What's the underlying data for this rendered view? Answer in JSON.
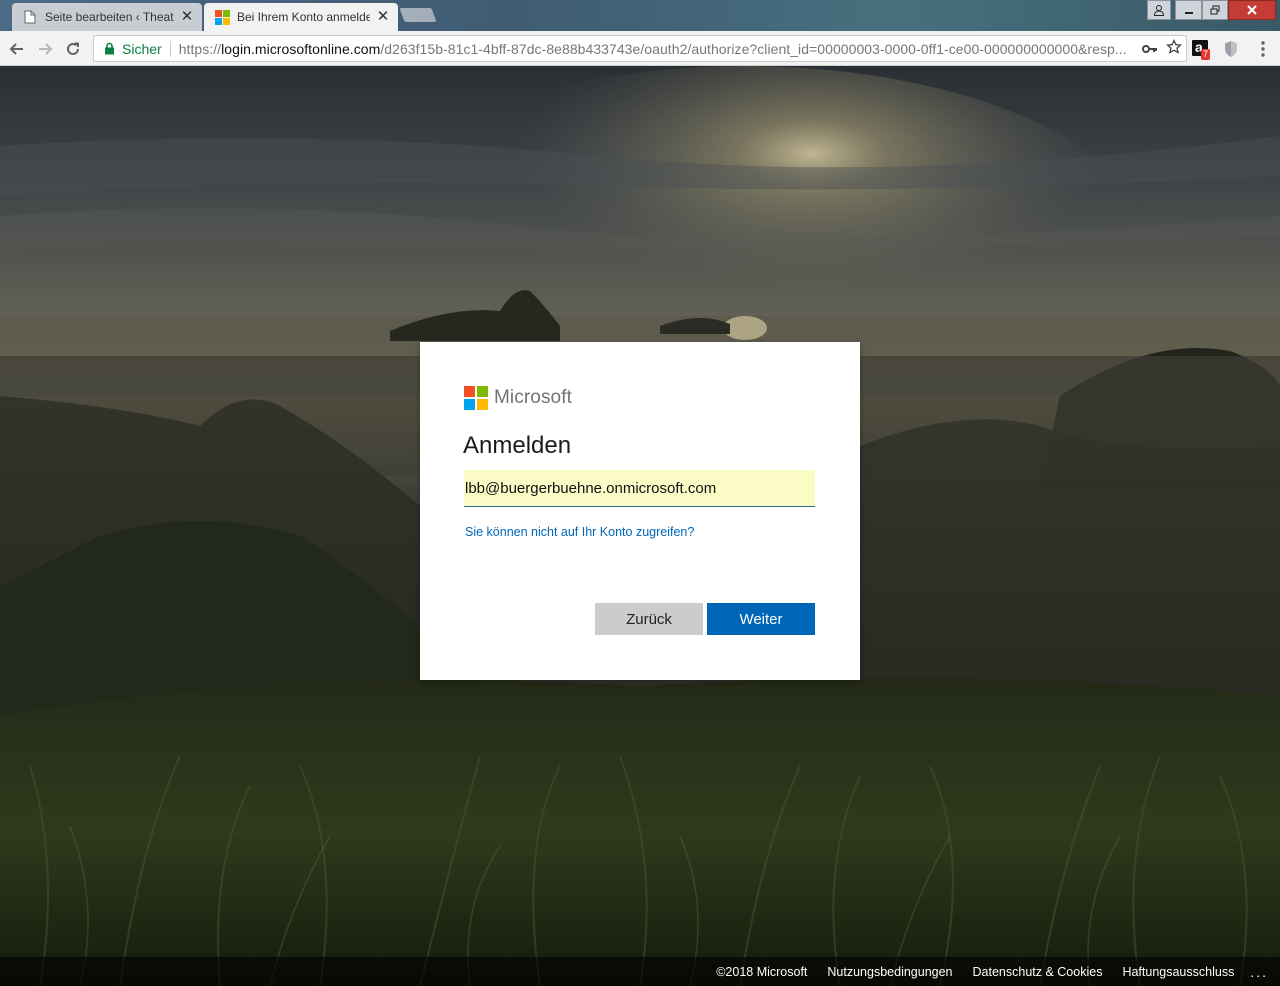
{
  "browser": {
    "tabs": [
      {
        "title": "Seite bearbeiten ‹ Theater",
        "active": false
      },
      {
        "title": "Bei Ihrem Konto anmelden",
        "active": true
      }
    ],
    "tab_close_glyph": "✕",
    "omnibox": {
      "secure_label": "Sicher",
      "url_scheme": "https://",
      "url_host": "login.microsoftonline.com",
      "url_path": "/d263f15b-81c1-4bff-87dc-8e88b433743e/oauth2/authorize?client_id=00000003-0000-0ff1-ce00-000000000000&resp..."
    },
    "extension_badge": "7",
    "extension_letter": "a"
  },
  "signin": {
    "brand": "Microsoft",
    "heading": "Anmelden",
    "email_value": "lbb@buergerbuehne.onmicrosoft.com",
    "cant_access_link": "Sie können nicht auf Ihr Konto zugreifen?",
    "back_label": "Zurück",
    "next_label": "Weiter"
  },
  "footer": {
    "copyright": "©2018 Microsoft",
    "terms": "Nutzungsbedingungen",
    "privacy": "Datenschutz & Cookies",
    "disclaimer": "Haftungsausschluss",
    "more": "..."
  },
  "colors": {
    "ms_red": "#f25022",
    "ms_green": "#7fba00",
    "ms_blue": "#00a4ef",
    "ms_yellow": "#ffb900",
    "primary_button": "#0067b8",
    "link": "#0067b8",
    "secure_green": "#0b8043"
  }
}
